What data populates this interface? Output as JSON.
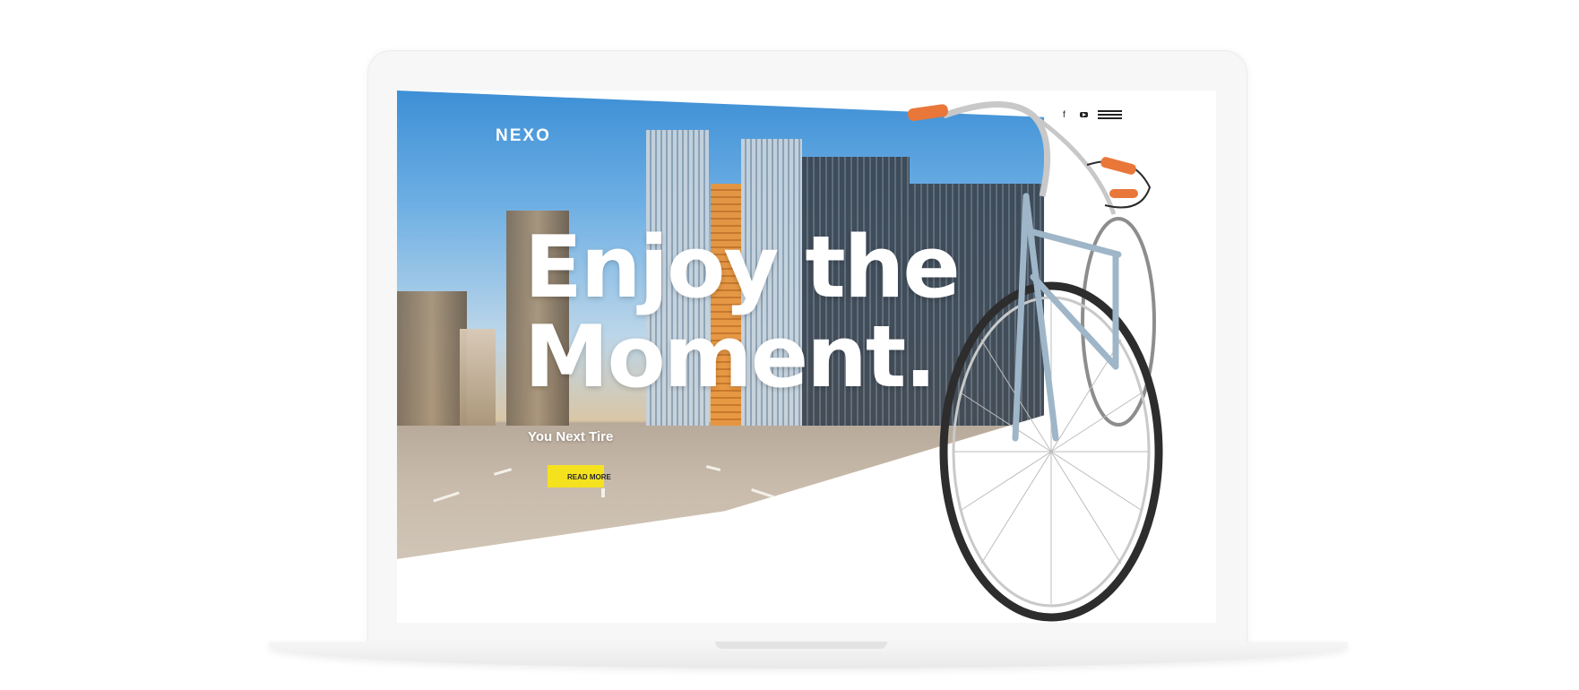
{
  "brand": {
    "logo": "NEXO"
  },
  "nav": {
    "social": [
      {
        "name": "facebook",
        "glyph": "f",
        "icon": "facebook-icon"
      },
      {
        "name": "youtube",
        "icon": "youtube-icon"
      }
    ],
    "menu_icon": "hamburger-menu-icon"
  },
  "hero": {
    "headline_line1": "Enjoy the",
    "headline_line2": "Moment.",
    "subtitle": "You Next Tire",
    "cta_label": "READ MORE"
  },
  "colors": {
    "accent": "#f5e21f",
    "headline": "#ffffff",
    "sky": "#3d8fd6"
  }
}
